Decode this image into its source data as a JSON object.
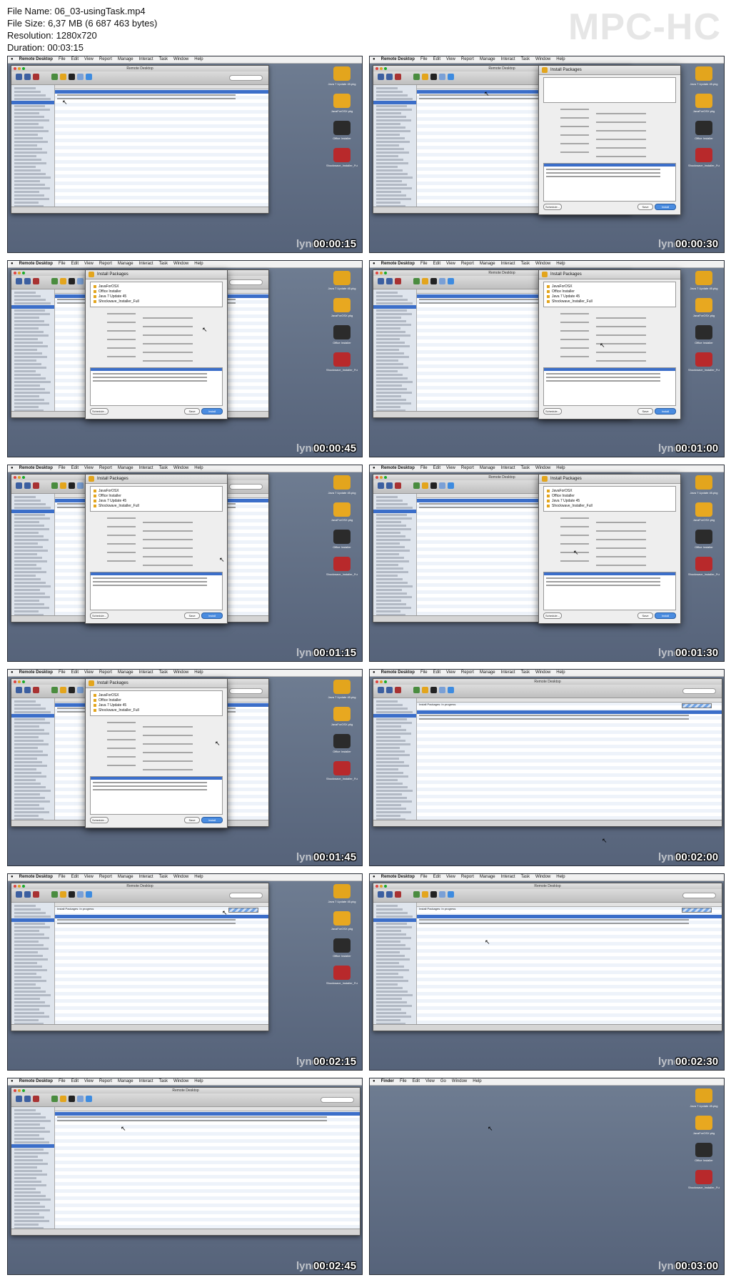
{
  "file_info": {
    "file_name": "File Name: 06_03-usingTask.mp4",
    "file_size": "File Size: 6,37 MB (6 687 463 bytes)",
    "resolution": "Resolution: 1280x720",
    "duration": "Duration: 00:03:15"
  },
  "logo": "MPC-HC",
  "watermark": "lynda",
  "menubar": {
    "app": "Remote Desktop",
    "items": [
      "File",
      "Edit",
      "View",
      "Report",
      "Manage",
      "Interact",
      "Task",
      "Window",
      "Help"
    ]
  },
  "finder_menubar": {
    "app": "Finder",
    "items": [
      "File",
      "Edit",
      "View",
      "Go",
      "Window",
      "Help"
    ]
  },
  "window_title": "Remote Desktop",
  "dialog": {
    "title": "Install Packages",
    "packages": [
      "JavaForOSX",
      "Office Installer",
      "Java 7 Update 45",
      "Shockwave_Installer_Full"
    ],
    "schedule_label": "Schedule...",
    "save_label": "Save",
    "install_label": "Install"
  },
  "task_banner": "Install Packages: In progress",
  "dock": [
    {
      "label": "Java 7 Update 45.pkg",
      "color": "#e3a51d"
    },
    {
      "label": "JavaForOSX.pkg",
      "color": "#e8a820"
    },
    {
      "label": "Office Installer",
      "color": "#2b2b2b"
    },
    {
      "label": "Shockwave_Installer_Full.pkg",
      "color": "#b8292b"
    }
  ],
  "frames": [
    {
      "timecode": "00:00:15"
    },
    {
      "timecode": "00:00:30"
    },
    {
      "timecode": "00:00:45"
    },
    {
      "timecode": "00:01:00"
    },
    {
      "timecode": "00:01:15"
    },
    {
      "timecode": "00:01:30"
    },
    {
      "timecode": "00:01:45"
    },
    {
      "timecode": "00:02:00"
    },
    {
      "timecode": "00:02:15"
    },
    {
      "timecode": "00:02:30"
    },
    {
      "timecode": "00:02:45"
    },
    {
      "timecode": "00:03:00"
    }
  ],
  "colors": {
    "desktop": "#5f6c82",
    "selection": "#3b6ec9",
    "accent": "#e3a51d"
  }
}
